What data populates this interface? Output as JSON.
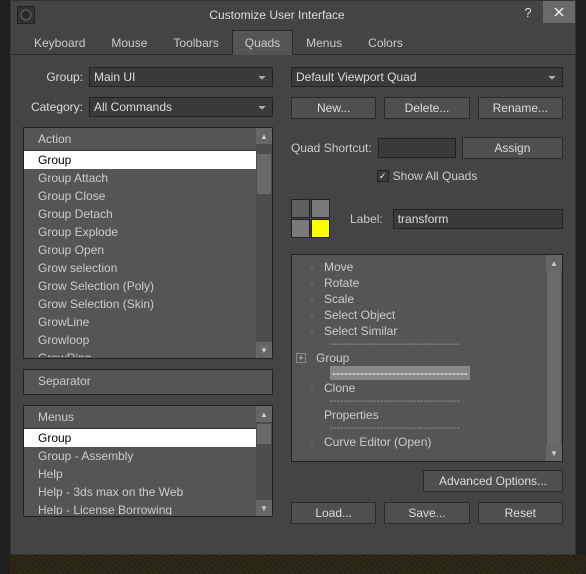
{
  "window": {
    "title": "Customize User Interface"
  },
  "tabs": [
    "Keyboard",
    "Mouse",
    "Toolbars",
    "Quads",
    "Menus",
    "Colors"
  ],
  "activeTab": "Quads",
  "left": {
    "groupLabel": "Group:",
    "group": "Main UI",
    "categoryLabel": "Category:",
    "category": "All Commands",
    "actionHeader": "Action",
    "actions": [
      "Group",
      "Group Attach",
      "Group Close",
      "Group Detach",
      "Group Explode",
      "Group Open",
      "Grow selection",
      "Grow Selection (Poly)",
      "Grow Selection (Skin)",
      "GrowLine",
      "Growloop",
      "GrowRing"
    ],
    "actionSelected": "Group",
    "separatorHeader": "Separator",
    "menusHeader": "Menus",
    "menus": [
      "Group",
      "Group - Assembly",
      "Help",
      "Help - 3ds max on the Web",
      "Help - License Borrowing"
    ],
    "menusSelected": "Group"
  },
  "right": {
    "quadSelect": "Default Viewport Quad",
    "btnNew": "New...",
    "btnDelete": "Delete...",
    "btnRename": "Rename...",
    "shortcutLabel": "Quad Shortcut:",
    "shortcutValue": "",
    "btnAssign": "Assign",
    "showAll": "Show All Quads",
    "labelLabel": "Label:",
    "labelValue": "transform",
    "tree": {
      "items": [
        "Move",
        "Rotate",
        "Scale",
        "Select Object",
        "Select Similar"
      ],
      "groupLabel": "Group",
      "after": [
        "Clone"
      ],
      "after2": [
        "Properties"
      ],
      "after3": [
        "Curve Editor (Open)"
      ]
    },
    "btnAdvanced": "Advanced Options...",
    "btnLoad": "Load...",
    "btnSave": "Save...",
    "btnReset": "Reset"
  },
  "colors": {
    "swatch1": "#606060",
    "swatch2": "#7a7a7a",
    "swatch3": "#7a7a7a",
    "swatch4": "#ffff00"
  }
}
